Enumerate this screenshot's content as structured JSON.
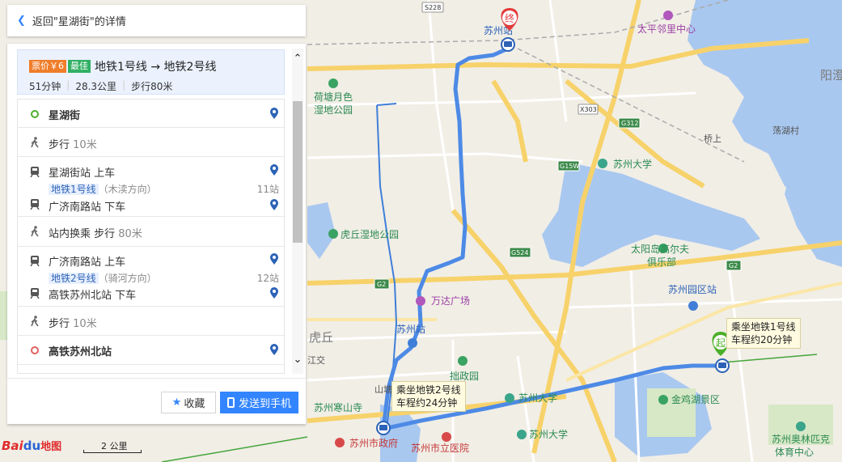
{
  "header": {
    "back_label": "返回\"星湖街\"的详情"
  },
  "plan": {
    "fare_badge": "票价￥6",
    "best_badge": "最佳",
    "lines_summary": "地铁1号线 → 地铁2号线",
    "duration": "51分钟",
    "distance": "28.3公里",
    "walk": "步行80米"
  },
  "steps": [
    {
      "kind": "start",
      "name": "星湖街"
    },
    {
      "kind": "walk",
      "text": "步行",
      "dist": "10米"
    },
    {
      "kind": "board",
      "station": "星湖街站",
      "action": "上车",
      "line": "地铁1号线",
      "direction": "（木渎方向）",
      "stops": "11站",
      "alight_station": "广济南路站",
      "alight_action": "下车"
    },
    {
      "kind": "transfer",
      "text": "站内换乘 步行",
      "dist": "80米"
    },
    {
      "kind": "board",
      "station": "广济南路站",
      "action": "上车",
      "line": "地铁2号线",
      "direction": "（骑河方向）",
      "stops": "12站",
      "alight_station": "高铁苏州北站",
      "alight_action": "下车"
    },
    {
      "kind": "walk",
      "text": "步行",
      "dist": "10米"
    },
    {
      "kind": "end",
      "name": "高铁苏州北站"
    }
  ],
  "buttons": {
    "favorite": "收藏",
    "send_to_phone": "发送到手机"
  },
  "map": {
    "tooltips": {
      "line1": [
        "乘坐地铁1号线",
        "车程约20分钟"
      ],
      "line2": [
        "乘坐地铁2号线",
        "车程约24分钟"
      ]
    },
    "markers": {
      "start": "起",
      "end": "终"
    },
    "labels": {
      "suzhou_station_top": "苏州站",
      "taiping_center": "太平邻里中心",
      "hetang": [
        "荷塘月色",
        "湿地公园"
      ],
      "yangcheng": "阳澄",
      "danghu": "荡湖村",
      "qiaoshang": "桥上",
      "suzhou_uni": "苏州大学",
      "huqiu_park": "虎丘湿地公园",
      "taiyangdao": [
        "太阳岛高尔夫",
        "俱乐部"
      ],
      "wanda": "万达广场",
      "huqiu": "虎丘",
      "suzhou_station": "苏州站",
      "zhuozheng": "拙政园",
      "suzhou_uni2": "苏州大学",
      "sip_station": "苏州园区站",
      "jinji_lake": "金鸡湖景区",
      "hanshan": "苏州寒山寺",
      "zhengfu": "苏州市政府",
      "hospital": "苏州市立医院",
      "suzhou_uni3": "苏州大学",
      "olympic": [
        "苏州奥林匹克",
        "体育中心"
      ],
      "shantang": "山塘",
      "jiangjiao": "江交"
    },
    "road_shields": [
      "S228",
      "X303",
      "G312",
      "G15W",
      "G524",
      "G2",
      "G2"
    ]
  },
  "scale": "2 公里",
  "logo": {
    "part1": "Bai",
    "part2": "du",
    "part3": "地图"
  },
  "colors": {
    "route": "#4d8ae6",
    "accent": "#3385ff",
    "fare": "#f07d2a",
    "best": "#31b065",
    "start_marker": "#4caf2a",
    "end_marker": "#e23b3b"
  }
}
